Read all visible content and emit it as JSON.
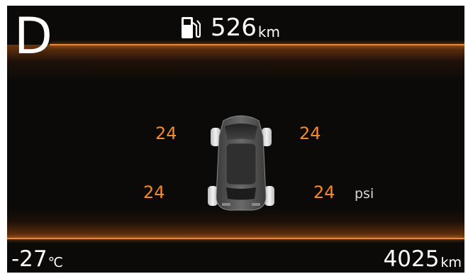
{
  "gear": {
    "label": "D"
  },
  "range": {
    "icon": "fuel-pump-icon",
    "value": "526",
    "unit": "km"
  },
  "tire_pressure": {
    "front_left": "24",
    "front_right": "24",
    "rear_left": "24",
    "rear_right": "24",
    "unit": "psi"
  },
  "outside_temp": {
    "value": "-27",
    "unit": "℃"
  },
  "odometer": {
    "value": "4025",
    "unit": "km"
  },
  "colors": {
    "accent": "#f08a2a",
    "background": "#0b0a09",
    "text": "#ffffff"
  }
}
